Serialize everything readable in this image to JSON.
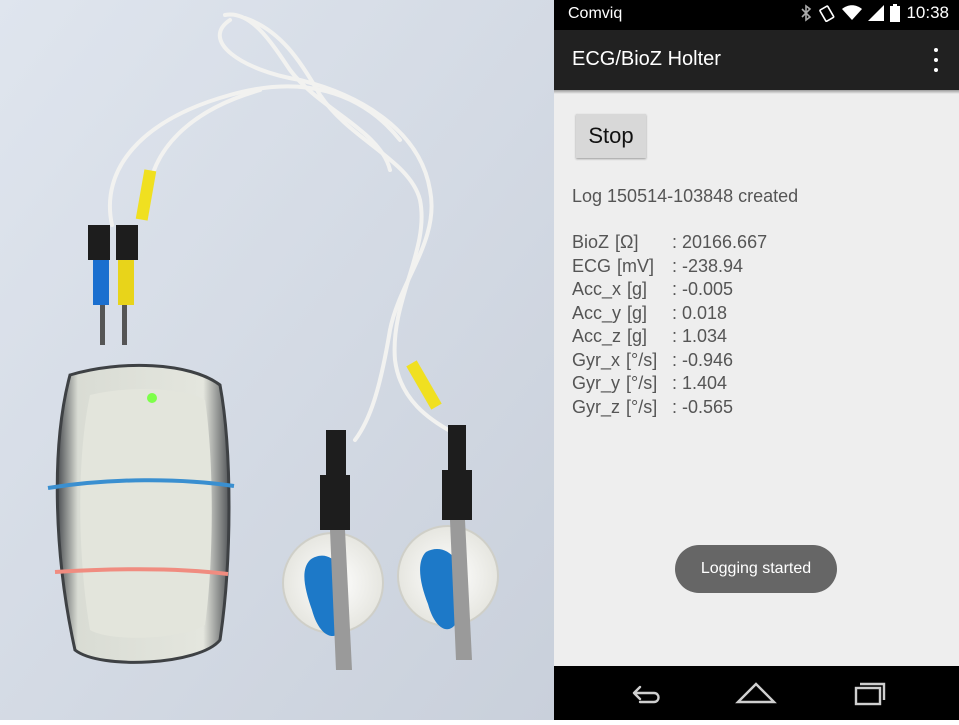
{
  "status_bar": {
    "carrier": "Comviq",
    "time": "10:38",
    "icons": [
      "bluetooth-icon",
      "rotate-icon",
      "wifi-icon",
      "signal-icon",
      "battery-icon"
    ]
  },
  "action_bar": {
    "title": "ECG/BioZ Holter",
    "overflow_icon": "more-vert-icon"
  },
  "main": {
    "stop_label": "Stop",
    "log_message": "Log 150514-103848 created",
    "readings": [
      {
        "label": "BioZ",
        "unit": "[Ω]",
        "value": ": 20166.667"
      },
      {
        "label": "ECG",
        "unit": "[mV]",
        "value": ": -238.94"
      },
      {
        "label": "Acc_x",
        "unit": "[g]",
        "value": ": -0.005"
      },
      {
        "label": "Acc_y",
        "unit": "[g]",
        "value": ": 0.018"
      },
      {
        "label": "Acc_z",
        "unit": "[g]",
        "value": ": 1.034"
      },
      {
        "label": "Gyr_x",
        "unit": "[°/s]",
        "value": ": -0.946"
      },
      {
        "label": "Gyr_y",
        "unit": "[°/s]",
        "value": ": 1.404"
      },
      {
        "label": "Gyr_z",
        "unit": "[°/s]",
        "value": ": -0.565"
      }
    ]
  },
  "toast": "Logging started",
  "nav_bar": [
    "back-icon",
    "home-icon",
    "recents-icon"
  ],
  "colors": {
    "status_bar": "#000000",
    "action_bar": "#212121",
    "screen_bg": "#eeeeee",
    "text": "#555555",
    "toast_bg": "#666666",
    "device_led": "#7dff4a"
  }
}
